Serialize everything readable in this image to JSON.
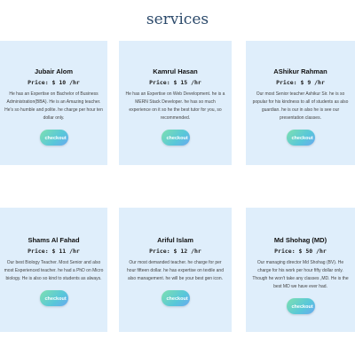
{
  "section": {
    "title": "services"
  },
  "cards": [
    {
      "name": "Jubair Alom",
      "price": "Price: $ 10 /hr",
      "description": "He has an Expertise on Bachelor of Business Administration(BBA). He is an Amazing teacher. He's so humble and polite. he charge per hour ten dollar only.",
      "button": "checkout"
    },
    {
      "name": "Kamrul Hasan",
      "price": "Price: $ 15 /hr",
      "description": "He has an Expertise on Web Development. he is a MERN Stack Developer. he has so much experience on it so he the best tutor for you, so recommended.",
      "button": "checkout"
    },
    {
      "name": "AShikur Rahman",
      "price": "Price: $ 9 /hr",
      "description": "Our most Senior teacher Ashikur Sir. he is so popular for his kindness to all of students as also guardian. he is our in also he is see our presentation classes.",
      "button": "checkout"
    },
    {
      "name": "Shams Al Fahad",
      "price": "Price: $ 11 /hr",
      "description": "Our best Biology Teacher. Most Senior and also most Experienced teacher. he had a PhD on Micro biology. He is also so kind to students as always.",
      "button": "checkout"
    },
    {
      "name": "Ariful Islam",
      "price": "Price: $ 12 /hr",
      "description": "Our most demanded teacher. he charge for per hour fifteen dollar. he has expertise on textile and also management. he will be your best gen icon.",
      "button": "checkout"
    },
    {
      "name": "Md Shohag (MD)",
      "price": "Price: $ 50 /hr",
      "description": "Our managing director Md Shohag (BV). He charge for his work per hour fifty dollar only. Though he won't take any classes ,MD. He is the best MD we have ever had.",
      "button": "checkout"
    }
  ]
}
